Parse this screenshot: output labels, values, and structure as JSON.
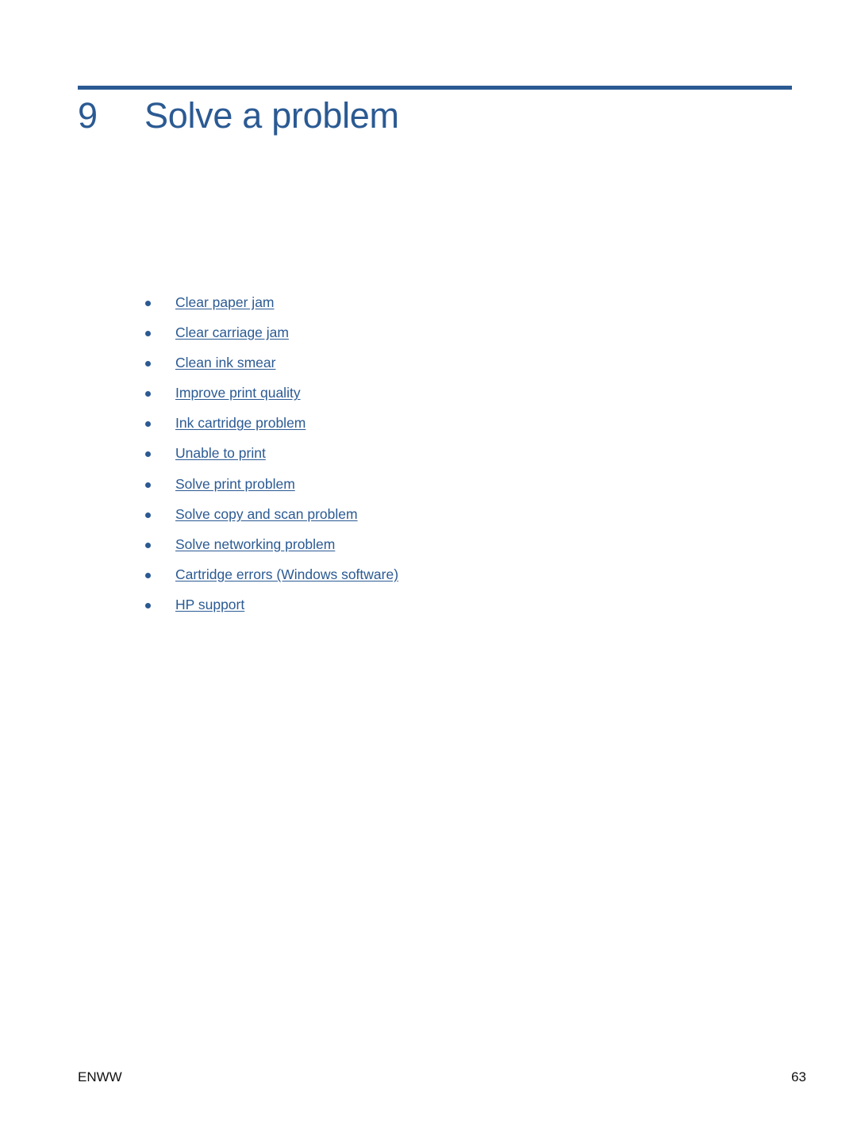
{
  "colors": {
    "accent": "#2b5a93",
    "text": "#111111",
    "background": "#ffffff"
  },
  "chapter": {
    "number": "9",
    "title": "Solve a problem"
  },
  "toc": {
    "items": [
      {
        "label": "Clear paper jam"
      },
      {
        "label": "Clear carriage jam"
      },
      {
        "label": "Clean ink smear"
      },
      {
        "label": "Improve print quality"
      },
      {
        "label": "Ink cartridge problem"
      },
      {
        "label": "Unable to print"
      },
      {
        "label": "Solve print problem"
      },
      {
        "label": "Solve copy and scan problem"
      },
      {
        "label": "Solve networking problem"
      },
      {
        "label": "Cartridge errors (Windows software)"
      },
      {
        "label": "HP support"
      }
    ]
  },
  "footer": {
    "left": "ENWW",
    "page_number": "63"
  }
}
